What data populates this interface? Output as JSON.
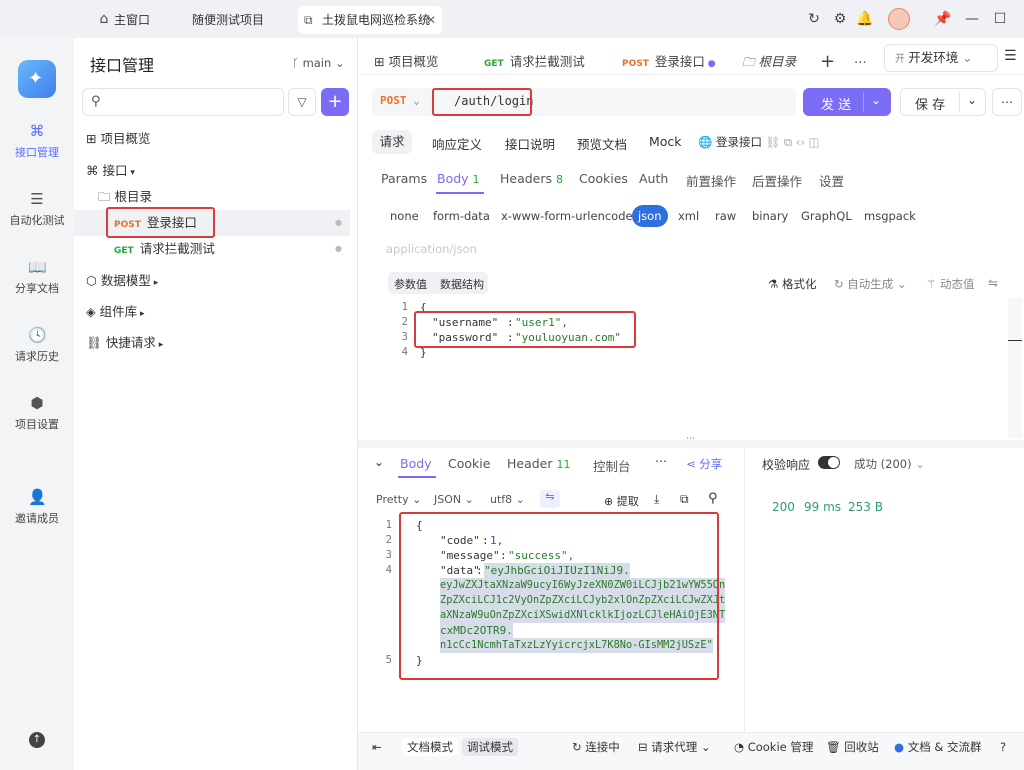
{
  "titlebar": {
    "tabs": [
      "主窗口",
      "随便测试项目",
      "土拨鼠电网巡检系统"
    ]
  },
  "rail": {
    "items": [
      "接口管理",
      "自动化测试",
      "分享文档",
      "请求历史",
      "项目设置",
      "邀请成员"
    ]
  },
  "sidebar": {
    "title": "接口管理",
    "branch": "main",
    "items": {
      "overview": "项目概览",
      "interfaces": "接口",
      "root": "根目录",
      "login_method": "POST",
      "login": "登录接口",
      "intercept_method": "GET",
      "intercept": "请求拦截测试",
      "models": "数据模型",
      "components": "组件库",
      "quick": "快捷请求"
    }
  },
  "tabs": {
    "overview": "项目概览",
    "get_method": "GET",
    "get_label": "请求拦截测试",
    "post_method": "POST",
    "post_label": "登录接口",
    "root": "根目录",
    "env": "开发环境"
  },
  "request": {
    "method": "POST",
    "url": "/auth/login",
    "send": "发 送",
    "save": "保 存"
  },
  "subtabs": [
    "请求",
    "响应定义",
    "接口说明",
    "预览文档",
    "Mock",
    "登录接口"
  ],
  "paramtabs": {
    "params": "Params",
    "body": "Body",
    "body_count": "1",
    "headers": "Headers",
    "headers_count": "8",
    "cookies": "Cookies",
    "auth": "Auth",
    "pre": "前置操作",
    "post": "后置操作",
    "settings": "设置"
  },
  "bodytypes": [
    "none",
    "form-data",
    "x-www-form-urlencoded",
    "json",
    "xml",
    "raw",
    "binary",
    "GraphQL",
    "msgpack"
  ],
  "body_placeholder": "application/json",
  "bodytools": {
    "param_value": "参数值",
    "data_structure": "数据结构",
    "format": "格式化",
    "auto_gen": "自动生成",
    "dynamic": "动态值"
  },
  "request_body": [
    {
      "n": "1",
      "t": "{"
    },
    {
      "n": "2",
      "k": "\"username\"",
      "v": "\"user1\","
    },
    {
      "n": "3",
      "k": "\"password\"",
      "v": "\"youluoyuan.com\""
    },
    {
      "n": "4",
      "t": "}"
    }
  ],
  "response": {
    "body": "Body",
    "cookie": "Cookie",
    "header": "Header",
    "header_count": "11",
    "console": "控制台",
    "share": "分享",
    "validate": "校验响应",
    "result": "成功 (200)",
    "pretty": "Pretty",
    "json": "JSON",
    "utf8": "utf8",
    "extract": "提取",
    "status": "200",
    "time": "99 ms",
    "size": "253 B"
  },
  "response_body": {
    "l1": "{",
    "code_k": "\"code\"",
    "code_v": "1,",
    "msg_k": "\"message\"",
    "msg_v": "\"success\",",
    "data_k": "\"data\"",
    "d1": "\"eyJhbGciOiJIUzI1NiJ9.",
    "d2": "eyJwZXJtaXNzaW9ucyI6WyJzeXN0ZW0iLCJjb21wYW55On",
    "d3": "ZpZXciLCJ1c2VyOnZpZXciLCJyb2xlOnZpZXciLCJwZXJt",
    "d4": "aXNzaW9uOnZpZXciXSwidXNlcklkIjozLCJleHAiOjE3NT",
    "d5": "cxMDc2OTR9.",
    "d6": "n1cCc1NcmhTaTxzLzYyicrcjxL7K8No-GIsMM2jUSzE\"",
    "l5": "}"
  },
  "footer": {
    "doc_mode": "文档模式",
    "debug_mode": "调试模式",
    "connecting": "连接中",
    "proxy": "请求代理",
    "cookie": "Cookie 管理",
    "trash": "回收站",
    "community": "文档 & 交流群"
  }
}
